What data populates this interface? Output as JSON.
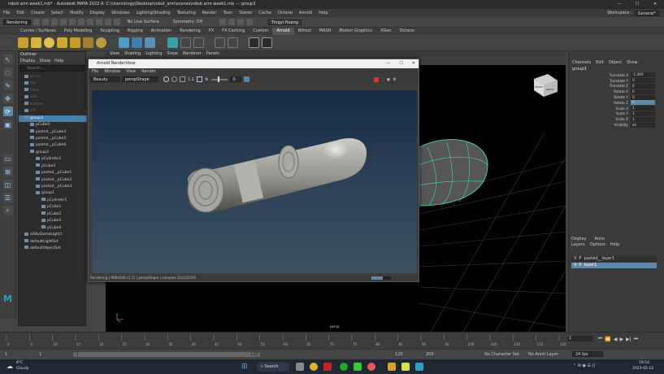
{
  "title": "robot arm week1.mb* - Autodesk MAYA 2022.4: C:\\Users\\tingy\\Desktop\\robot_arm\\scenes\\robot arm week1.mb --- group3",
  "menu": [
    "File",
    "Edit",
    "Create",
    "Select",
    "Modify",
    "Display",
    "Windows",
    "Lighting/Shading",
    "Texturing",
    "Render",
    "Toon",
    "Stereo",
    "Cache",
    "Octane",
    "Arnold",
    "Help"
  ],
  "workspace": {
    "label": "Workspace :",
    "value": "General*"
  },
  "status": {
    "mode": "Rendering",
    "live_surface": "No Live Surface",
    "symmetry": "Symmetry: Off",
    "user": "Tingyi Huang"
  },
  "shelf_tabs": [
    "Curves / Surfaces",
    "Poly Modeling",
    "Sculpting",
    "Rigging",
    "Animation",
    "Rendering",
    "FX",
    "FX Caching",
    "Custom",
    "Arnold",
    "Bifrost",
    "MASH",
    "Motion Graphics",
    "XGen",
    "Octane"
  ],
  "active_shelf_tab": "Arnold",
  "outliner": {
    "title": "Outliner",
    "menu": [
      "Display",
      "Show",
      "Help"
    ],
    "search_placeholder": "Search...",
    "items": [
      {
        "label": "persp",
        "indent": 1,
        "dim": true
      },
      {
        "label": "top",
        "indent": 1,
        "dim": true
      },
      {
        "label": "front",
        "indent": 1,
        "dim": true
      },
      {
        "label": "side",
        "indent": 1,
        "dim": true
      },
      {
        "label": "bottom",
        "indent": 1,
        "dim": true
      },
      {
        "label": "left",
        "indent": 1,
        "dim": true
      },
      {
        "label": "group3",
        "indent": 1,
        "selected": true
      },
      {
        "label": "pCube5",
        "indent": 2
      },
      {
        "label": "pasted__pCube4",
        "indent": 2
      },
      {
        "label": "pasted__pCube5",
        "indent": 2
      },
      {
        "label": "pasted__pCube6",
        "indent": 2
      },
      {
        "label": "group2",
        "indent": 2
      },
      {
        "label": "pCylinder2",
        "indent": 3
      },
      {
        "label": "pCube5",
        "indent": 3
      },
      {
        "label": "pasted__pCube1",
        "indent": 3
      },
      {
        "label": "pasted__pCube2",
        "indent": 3
      },
      {
        "label": "pasted__pCube3",
        "indent": 3
      },
      {
        "label": "group1",
        "indent": 3
      },
      {
        "label": "pCylinder1",
        "indent": 4
      },
      {
        "label": "pCube1",
        "indent": 4
      },
      {
        "label": "pCube2",
        "indent": 4
      },
      {
        "label": "pCube3",
        "indent": 4
      },
      {
        "label": "pCube4",
        "indent": 4
      },
      {
        "label": "aiSkyDomeLight1",
        "indent": 1
      },
      {
        "label": "defaultLightSet",
        "indent": 1
      },
      {
        "label": "defaultObjectSet",
        "indent": 1
      }
    ]
  },
  "viewport": {
    "menu": [
      "View",
      "Shading",
      "Lighting",
      "Show",
      "Renderer",
      "Panels"
    ],
    "camera_label": "persp",
    "cube_front": "FRONT",
    "cube_right": "RIGHT"
  },
  "render_view": {
    "title": "Arnold RenderView",
    "menu": [
      "File",
      "Window",
      "View",
      "Render"
    ],
    "aov": "Beauty",
    "camera": "perspShape",
    "zoom": "1:1",
    "exposure": "0",
    "status": "Rendering | 960x540 (1:1) | perspShape | samples 3/2/2/2/2/2"
  },
  "channel_box": {
    "menu": [
      "Channels",
      "Edit",
      "Object",
      "Show"
    ],
    "object": "group3",
    "attrs": [
      {
        "name": "Translate X",
        "value": "-1.440"
      },
      {
        "name": "Translate Y",
        "value": "0"
      },
      {
        "name": "Translate Z",
        "value": "0"
      },
      {
        "name": "Rotate X",
        "value": "0"
      },
      {
        "name": "Rotate Y",
        "value": "0"
      },
      {
        "name": "Rotate Z",
        "value": "0",
        "highlight": true
      },
      {
        "name": "Scale X",
        "value": "1"
      },
      {
        "name": "Scale Y",
        "value": "1"
      },
      {
        "name": "Scale Z",
        "value": "1"
      },
      {
        "name": "Visibility",
        "value": "on"
      }
    ]
  },
  "layers": {
    "tabs": [
      "Display",
      "Anim"
    ],
    "menu": [
      "Layers",
      "Options",
      "Help"
    ],
    "rows": [
      {
        "v": "V",
        "p": "P",
        "name": "pasted__layer1"
      },
      {
        "v": "V",
        "p": "P",
        "name": "layer1",
        "selected": true
      }
    ]
  },
  "timeline": {
    "ticks": [
      "0",
      "5",
      "10",
      "15",
      "20",
      "25",
      "30",
      "35",
      "40",
      "45",
      "50",
      "55",
      "60",
      "65",
      "70",
      "75",
      "80",
      "85",
      "90",
      "95",
      "100",
      "105",
      "110",
      "115",
      "120"
    ],
    "current": "1"
  },
  "range": {
    "start": "1",
    "start2": "1",
    "slider_start": "1",
    "slider_end": "120",
    "end2": "120",
    "end": "200",
    "fps": "24 fps",
    "char_set": "No Character Set",
    "anim_layer": "No Anim Layer"
  },
  "taskbar": {
    "weather_temp": "8°C",
    "weather_desc": "Cloudy",
    "search": "Search",
    "time": "19:54",
    "date": "2023-02-12"
  },
  "colors": {
    "accent": "#5d8aa8",
    "wire": "#3fe0a8",
    "viewport_bg": "#000000"
  }
}
